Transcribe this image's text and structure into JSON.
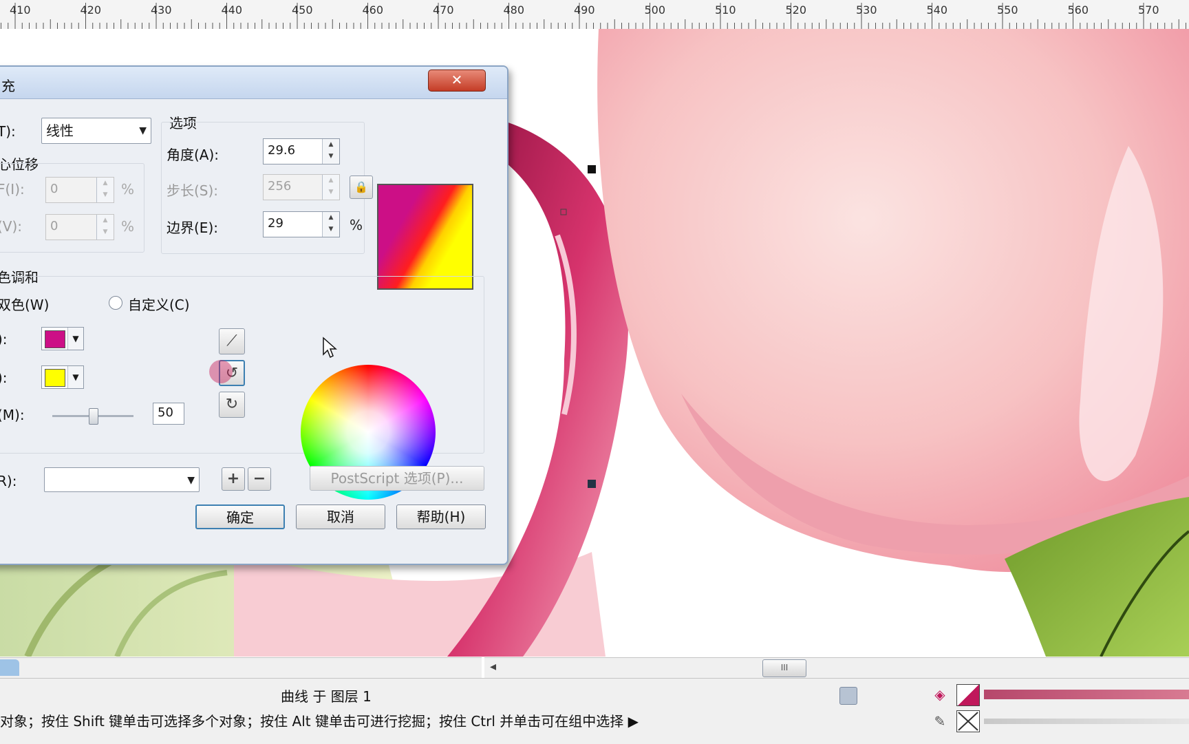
{
  "ruler": {
    "labels": [
      "410",
      "420",
      "430",
      "440",
      "450",
      "460",
      "470",
      "480",
      "490",
      "500",
      "510",
      "520",
      "530",
      "540",
      "550",
      "560",
      "570"
    ]
  },
  "dialog": {
    "title": "充",
    "close_label": "✕",
    "type_label": "T):",
    "type_value": "线性",
    "offset_group_label": "心位移",
    "h_label": "F(I):",
    "h_value": "0",
    "v_label": "(V):",
    "v_value": "0",
    "pct": "%",
    "options_group_label": "选项",
    "angle_label": "角度(A):",
    "angle_value": "29.6",
    "steps_label": "步长(S):",
    "steps_value": "256",
    "edge_label": "边界(E):",
    "edge_value": "29",
    "blend_group_label": "色调和",
    "two_color_label": "双色(W)",
    "custom_label": "自定义(C)",
    "from_label": "):",
    "from_color": "#cc0f86",
    "to_label": "):",
    "to_color": "#ffff00",
    "mid_label": "(M):",
    "mid_value": "50",
    "mid_fraction": 0.5,
    "preset_label": "R):",
    "preset_value": "",
    "postscript_label": "PostScript 选项(P)...",
    "ok_label": "确定",
    "cancel_label": "取消",
    "help_label": "帮助(H)"
  },
  "hscroll": {
    "thumb_glyph": "III",
    "left_arrow": "◂"
  },
  "status": {
    "layer_text": "曲线 于 图层 1",
    "hint_text": "对象；按住 Shift 键单击可选择多个对象；按住 Alt 键单击可进行挖掘；按住 Ctrl 并单击可在组中选择 ▶"
  },
  "colors": {
    "petal_pink": "#f4a9b4",
    "petal_dark": "#c0185b",
    "leaf_green": "#8dbb3c",
    "fill_swatch": "#c0185b"
  }
}
